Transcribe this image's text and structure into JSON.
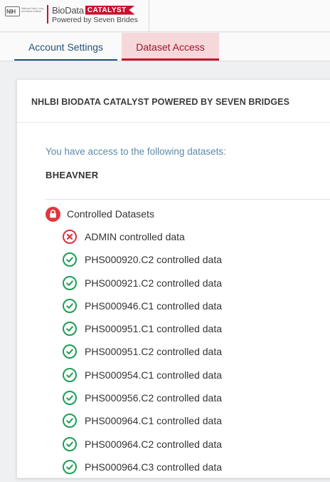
{
  "header": {
    "nih_logo_text": "NIH",
    "nih_logo_subtext": "National Heart, Lung, and Blood Institute",
    "brand_name": "BioData",
    "brand_flag": "CATALYST",
    "brand_tagline": "Powered by Seven Brides"
  },
  "tabs": [
    {
      "label": "Account Settings",
      "active": false
    },
    {
      "label": "Dataset Access",
      "active": true
    }
  ],
  "card": {
    "title": "NHLBI BIODATA CATALYST POWERED BY SEVEN BRIDGES",
    "intro": "You have access to the following datasets:",
    "username": "BHEAVNER",
    "group": {
      "label": "Controlled Datasets",
      "icon": "lock-icon"
    },
    "datasets": [
      {
        "label": "ADMIN controlled data",
        "status": "denied"
      },
      {
        "label": "PHS000920.C2 controlled data",
        "status": "granted"
      },
      {
        "label": "PHS000921.C2 controlled data",
        "status": "granted"
      },
      {
        "label": "PHS000946.C1 controlled data",
        "status": "granted"
      },
      {
        "label": "PHS000951.C1 controlled data",
        "status": "granted"
      },
      {
        "label": "PHS000951.C2 controlled data",
        "status": "granted"
      },
      {
        "label": "PHS000954.C1 controlled data",
        "status": "granted"
      },
      {
        "label": "PHS000956.C2 controlled data",
        "status": "granted"
      },
      {
        "label": "PHS000964.C1 controlled data",
        "status": "granted"
      },
      {
        "label": "PHS000964.C2 controlled data",
        "status": "granted"
      },
      {
        "label": "PHS000964.C3 controlled data",
        "status": "granted"
      }
    ]
  },
  "colors": {
    "brand_red": "#c8102e",
    "account_tab": "#24527a",
    "intro_text": "#5d8aa8",
    "granted": "#1e9e55",
    "denied": "#d9323f"
  }
}
